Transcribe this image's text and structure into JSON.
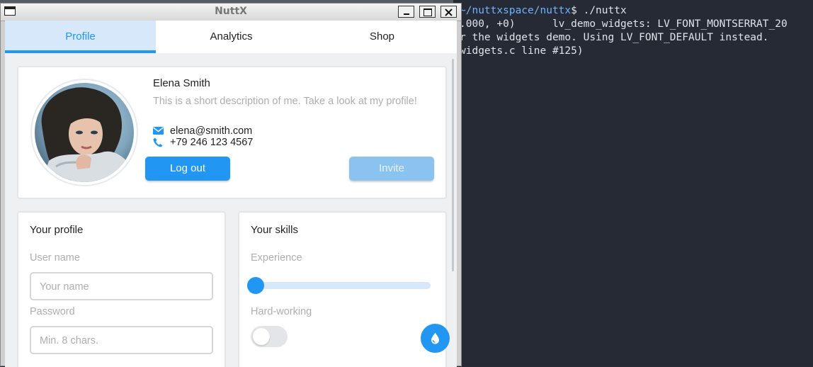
{
  "window": {
    "title": "NuttX"
  },
  "tabs": [
    {
      "label": "Profile"
    },
    {
      "label": "Analytics"
    },
    {
      "label": "Shop"
    }
  ],
  "profile": {
    "name": "Elena Smith",
    "description": "This is a short description of me. Take a look at my profile!",
    "email": "elena@smith.com",
    "phone": "+79 246 123 4567",
    "logout_label": "Log out",
    "invite_label": "Invite"
  },
  "your_profile": {
    "title": "Your profile",
    "username_label": "User name",
    "username_placeholder": "Your name",
    "password_label": "Password",
    "password_placeholder": "Min. 8 chars."
  },
  "skills": {
    "title": "Your skills",
    "experience_label": "Experience",
    "experience_value": 0,
    "hardworking_label": "Hard-working",
    "hardworking_on": false
  },
  "terminal": {
    "prompt_path": "~/nuttxspace/nuttx",
    "prompt_cmd": "$ ./nuttx",
    "lines": [
      ".000, +0)      lv_demo_widgets: LV_FONT_MONTSERRAT_20",
      "r the widgets demo. Using LV_FONT_DEFAULT instead.",
      "widgets.c line #125)"
    ]
  },
  "colors": {
    "accent": "#2196f3",
    "tab_active_bg": "#d6e8f9",
    "invite_disabled": "#8ac2f0",
    "terminal_bg": "#252a35"
  }
}
